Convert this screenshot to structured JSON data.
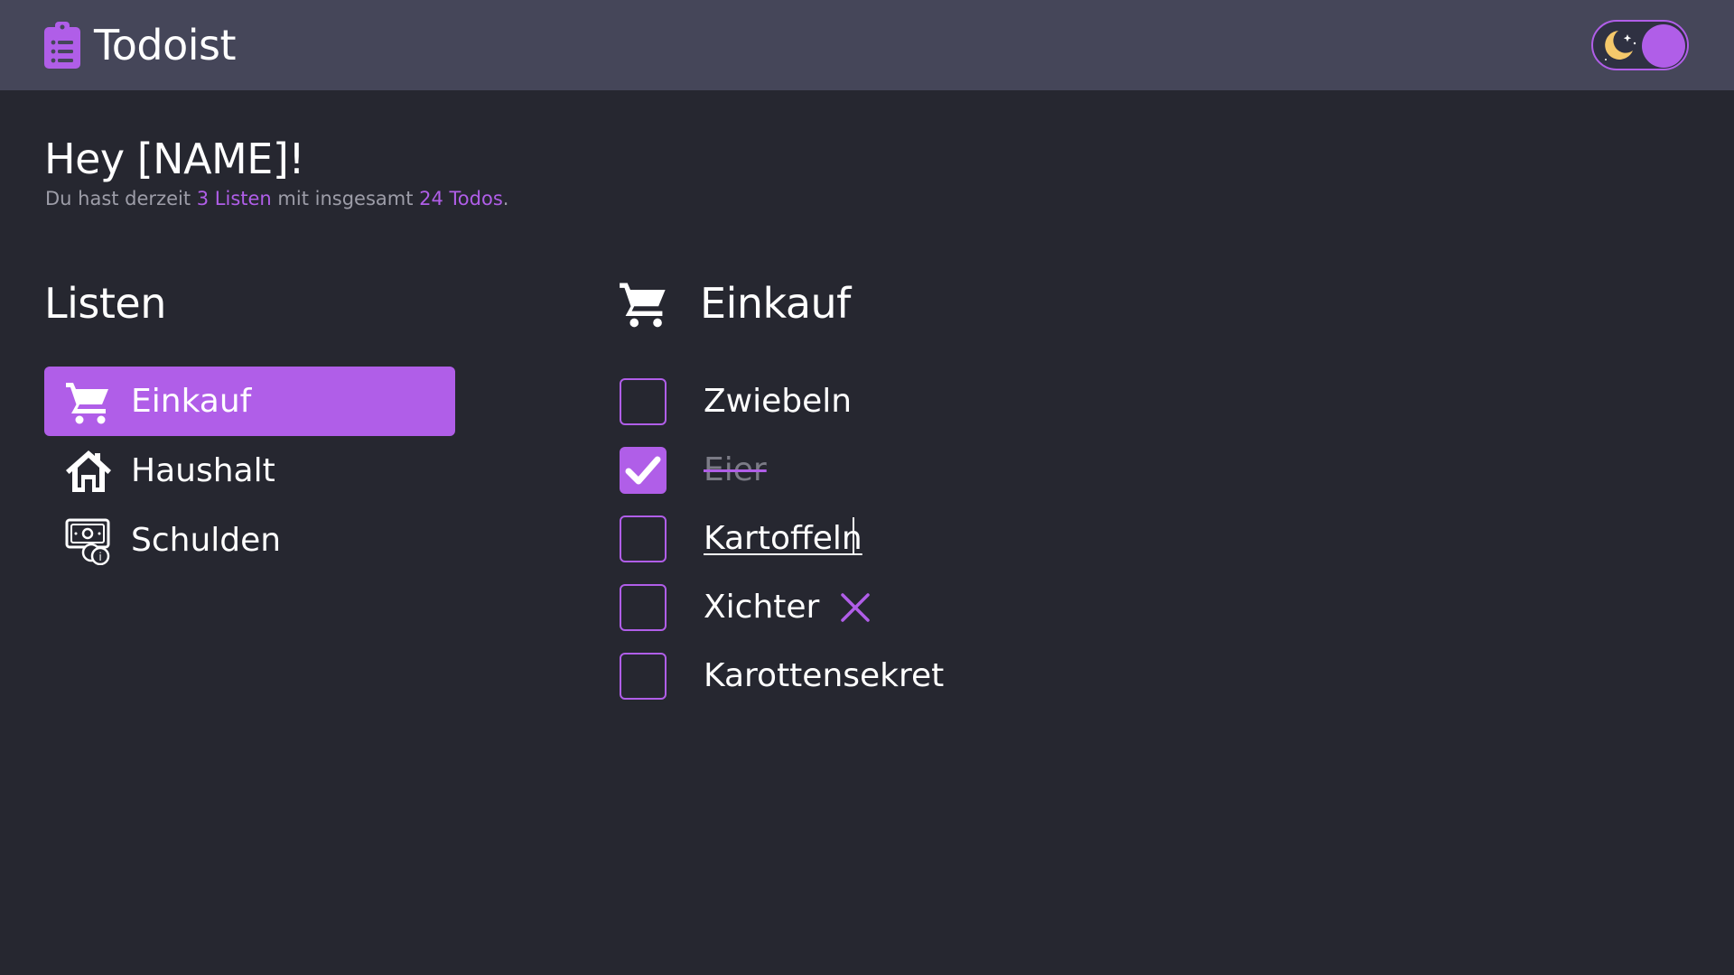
{
  "header": {
    "app_title": "Todoist",
    "logo_icon": "clipboard-list-icon",
    "theme_toggle": {
      "icon": "moon-stars-icon",
      "state": "dark"
    }
  },
  "greeting": {
    "title": "Hey [NAME]!",
    "summary_prefix": "Du hast derzeit ",
    "lists_count": "3 Listen",
    "summary_middle": " mit insgesamt ",
    "todos_count": "24 Todos",
    "summary_suffix": "."
  },
  "lists": {
    "heading": "Listen",
    "items": [
      {
        "label": "Einkauf",
        "icon": "shopping-cart-icon",
        "active": true
      },
      {
        "label": "Haushalt",
        "icon": "house-icon",
        "active": false
      },
      {
        "label": "Schulden",
        "icon": "money-bill-icon",
        "active": false
      }
    ]
  },
  "detail": {
    "icon": "shopping-cart-icon",
    "title": "Einkauf",
    "todos": [
      {
        "label": "Zwiebeln",
        "done": false
      },
      {
        "label": "Eier",
        "done": true
      },
      {
        "label": "Kartoffeln",
        "done": false,
        "editing": true
      },
      {
        "label": "Xichter",
        "done": false,
        "hover_delete": true
      },
      {
        "label": "Karottensekret",
        "done": false
      }
    ]
  },
  "colors": {
    "accent": "#b05ee8",
    "background": "#262730",
    "header": "#454659",
    "muted_text": "#9d9da8"
  }
}
